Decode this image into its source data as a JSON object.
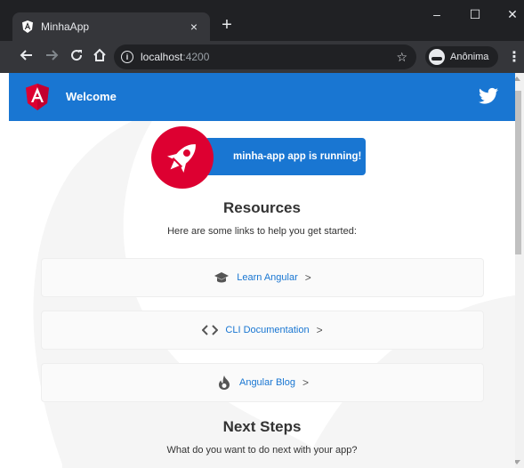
{
  "browser": {
    "tab_title": "MinhaApp",
    "tab_close": "×",
    "new_tab": "+",
    "minimize": "–",
    "maximize": "☐",
    "close": "✕",
    "url_host": "localhost",
    "url_port": ":4200",
    "profile_label": "Anônima"
  },
  "app": {
    "title": "Welcome",
    "running_text": "minha-app app is running!",
    "resources_title": "Resources",
    "resources_subtitle": "Here are some links to help you get started:",
    "links": [
      {
        "label": "Learn Angular",
        "icon": "graduation-cap-icon"
      },
      {
        "label": "CLI Documentation",
        "icon": "code-brackets-icon"
      },
      {
        "label": "Angular Blog",
        "icon": "flame-icon"
      }
    ],
    "next_steps_title": "Next Steps",
    "next_steps_subtitle": "What do you want to do next with your app?"
  },
  "colors": {
    "brand": "#1976d2",
    "angular_red": "#dd0031",
    "chrome_dark": "#202124"
  }
}
